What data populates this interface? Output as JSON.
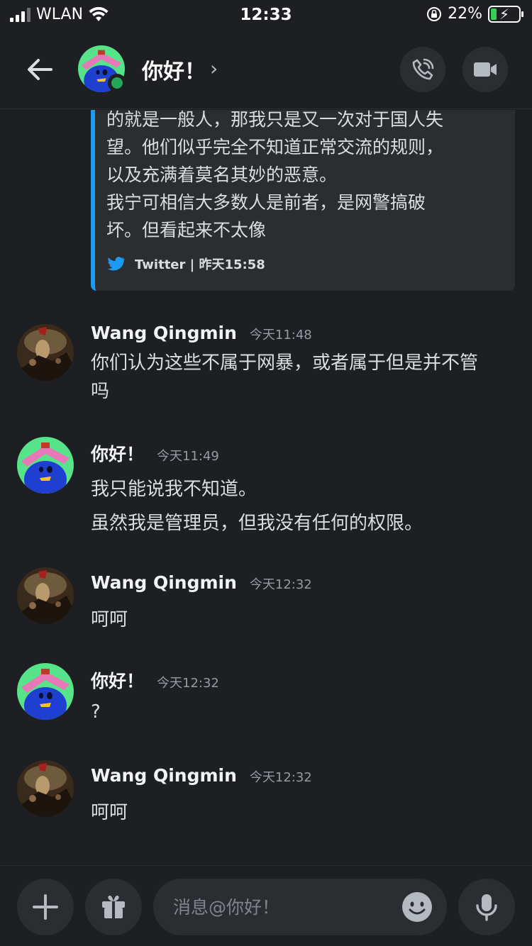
{
  "status_bar": {
    "carrier": "WLAN",
    "time": "12:33",
    "battery_percent_text": "22%",
    "battery_level": 0.22
  },
  "header": {
    "title": "你好！",
    "chevron": "›",
    "online_status_color": "#23a55a",
    "icons": [
      "back-arrow-icon",
      "phone-call-icon",
      "video-camera-icon"
    ]
  },
  "embed": {
    "lines": [
      "的就是一般人，那我只是又一次对于国人失",
      "望。他们似乎完全不知道正常交流的规则，",
      "以及充满着莫名其妙的恶意。",
      "我宁可相信大多数人是前者，是网警搞破",
      "坏。但看起来不太像"
    ],
    "footer": "Twitter | 昨天15:58",
    "accent_color": "#1d9bf0"
  },
  "messages": [
    {
      "author": "Wang Qingmin",
      "time": "今天11:48",
      "lines": [
        "你们认为这些不属于网暴，或者属于但是并不管",
        "吗"
      ]
    },
    {
      "author": "你好！",
      "time": "今天11:49",
      "lines": [
        "我只能说我不知道。",
        "虽然我是管理员，但我没有任何的权限。"
      ]
    },
    {
      "author": "Wang Qingmin",
      "time": "今天12:32",
      "lines": [
        "呵呵"
      ]
    },
    {
      "author": "你好！",
      "time": "今天12:32",
      "lines": [
        "?"
      ]
    },
    {
      "author": "Wang Qingmin",
      "time": "今天12:32",
      "lines": [
        "呵呵"
      ]
    }
  ],
  "composer": {
    "placeholder": "消息@你好！",
    "icons": [
      "plus-icon",
      "gift-icon",
      "emoji-icon",
      "microphone-icon"
    ]
  }
}
